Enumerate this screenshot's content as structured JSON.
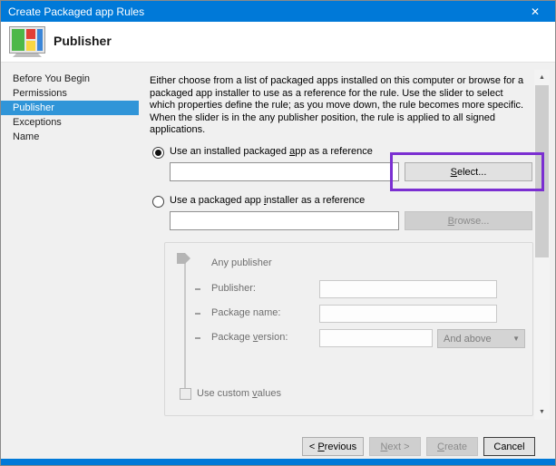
{
  "window": {
    "title": "Create Packaged app Rules",
    "accent_color": "#0079d8"
  },
  "icons": {
    "close": "✕",
    "dropdown": "▼",
    "scroll_up": "▲",
    "scroll_down": "▼"
  },
  "header": {
    "title": "Publisher"
  },
  "sidebar": {
    "selected_index": 2,
    "items": [
      {
        "label": "Before You Begin"
      },
      {
        "label": "Permissions"
      },
      {
        "label": "Publisher"
      },
      {
        "label": "Exceptions"
      },
      {
        "label": "Name"
      }
    ]
  },
  "content": {
    "description": "Either choose from a list of packaged apps installed on this computer or browse for a packaged app installer to use as a reference for the rule. Use the slider to select which properties define the rule; as you move down, the rule becomes more specific. When the slider is in the any publisher position, the rule is applied to all signed applications.",
    "installed_radio": {
      "pre": "Use an installed packaged ",
      "key": "a",
      "post": "pp as a reference",
      "selected": true
    },
    "installed_value": "",
    "select_button": {
      "pre": "",
      "key": "S",
      "post": "elect..."
    },
    "installer_radio": {
      "pre": "Use a packaged app ",
      "key": "i",
      "post": "nstaller as a reference",
      "selected": false
    },
    "installer_value": "",
    "browse_button": {
      "pre": "",
      "key": "B",
      "post": "rowse...",
      "disabled": true
    },
    "slider_group": {
      "any_publisher_label": "Any publisher",
      "publisher_label": "Publisher:",
      "publisher_value": "",
      "package_name_label": "Package name:",
      "package_name_value": "",
      "package_version": {
        "pre": "Package ",
        "key": "v",
        "post": "ersion:"
      },
      "package_version_value": "",
      "and_above": "And above",
      "custom_values": {
        "pre": "Use custom ",
        "key": "v",
        "post": "alues",
        "checked": false
      }
    }
  },
  "footer": {
    "previous": {
      "pre": "< ",
      "key": "P",
      "post": "revious",
      "enabled": true
    },
    "next": {
      "pre": "",
      "key": "N",
      "post": "ext >",
      "enabled": false
    },
    "create": {
      "pre": "",
      "key": "C",
      "post": "reate",
      "enabled": false
    },
    "cancel": "Cancel"
  },
  "annotation": {
    "purpose": "highlight-select-button",
    "color": "#7b2fd1"
  }
}
